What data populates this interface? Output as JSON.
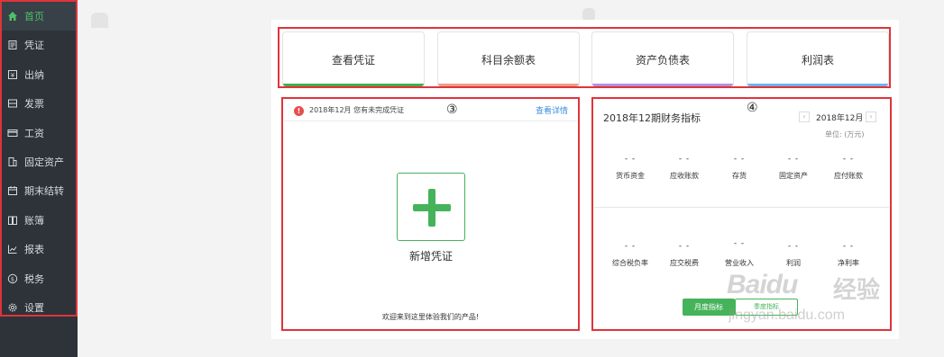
{
  "sidebar": {
    "items": [
      {
        "label": "首页",
        "icon": "home-icon",
        "active": true
      },
      {
        "label": "凭证",
        "icon": "voucher-icon"
      },
      {
        "label": "出纳",
        "icon": "cashier-icon"
      },
      {
        "label": "发票",
        "icon": "invoice-icon"
      },
      {
        "label": "工资",
        "icon": "salary-icon"
      },
      {
        "label": "固定资产",
        "icon": "building-icon"
      },
      {
        "label": "期末结转",
        "icon": "calendar-icon"
      },
      {
        "label": "账簿",
        "icon": "book-icon"
      },
      {
        "label": "报表",
        "icon": "chart-icon"
      },
      {
        "label": "税务",
        "icon": "tax-icon"
      },
      {
        "label": "设置",
        "icon": "gear-icon"
      }
    ],
    "active_color": "#4fc06a"
  },
  "quick_links": [
    {
      "label": "查看凭证",
      "color": "#3fae4f"
    },
    {
      "label": "科目余额表",
      "color": "#ef9c87"
    },
    {
      "label": "资产负债表",
      "color": "#b58fe0"
    },
    {
      "label": "利润表",
      "color": "#6eb3ef"
    }
  ],
  "voucher_panel": {
    "annotation": "③",
    "notice": "2018年12月 您有未完成凭证",
    "detail_link": "查看详情",
    "add_label": "新增凭证",
    "welcome": "欢迎来到这里体验我们的产品!"
  },
  "finance_panel": {
    "annotation": "④",
    "title": "2018年12期财务指标",
    "period": "2018年12月",
    "unit": "单位: (万元)",
    "metrics_row1": [
      {
        "value": "- -",
        "label": "货币资金"
      },
      {
        "value": "- -",
        "label": "应收账款"
      },
      {
        "value": "- -",
        "label": "存货"
      },
      {
        "value": "- -",
        "label": "固定资产"
      },
      {
        "value": "- -",
        "label": "应付账款"
      }
    ],
    "metrics_row2": [
      {
        "value": "- -",
        "label": "综合税负率"
      },
      {
        "value": "- -",
        "label": "应交税费"
      },
      {
        "value": "- -",
        "label": "营业收入"
      },
      {
        "value": "- -",
        "label": "利润"
      },
      {
        "value": "- -",
        "label": "净利率"
      }
    ],
    "month_button": "月度指标",
    "quarter_button": "季度指标"
  },
  "watermark": {
    "brand": "Baidu",
    "brand_cn": "经验",
    "url": "jingyan.baidu.com"
  },
  "colors": {
    "sidebar_bg": "#2d3339",
    "highlight_frame": "#e0343a",
    "accent_green": "#45b35a",
    "link_blue": "#3b8fe0"
  }
}
